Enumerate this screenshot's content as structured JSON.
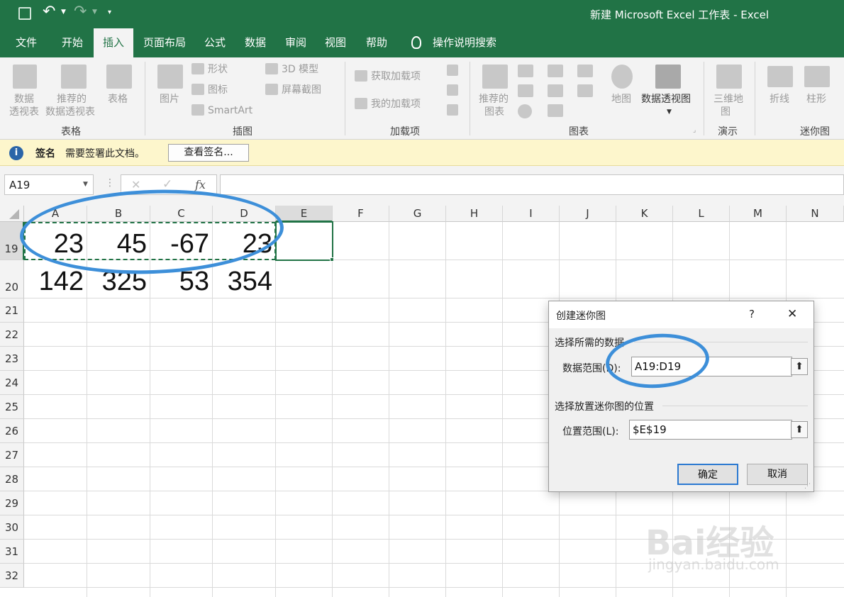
{
  "title": {
    "text": "新建 Microsoft Excel 工作表  -  Excel",
    "save_icon": "save-icon",
    "undo_icon": "undo-icon",
    "redo_icon": "redo-icon",
    "customize_icon": "customize-arrow-icon"
  },
  "menu": {
    "items": [
      "文件",
      "开始",
      "插入",
      "页面布局",
      "公式",
      "数据",
      "审阅",
      "视图",
      "帮助"
    ],
    "active": "插入",
    "search_label": "操作说明搜索"
  },
  "ribbon": {
    "pivot_line1": "数据",
    "pivot_line2": "透视表",
    "rec_pivot_line1": "推荐的",
    "rec_pivot_line2": "数据透视表",
    "table": "表格",
    "group_tables": "表格",
    "pictures": "图片",
    "shapes": "形状",
    "icons": "图标",
    "smartart": "SmartArt",
    "model3d": "3D 模型",
    "screenshot": "屏幕截图",
    "group_illustrations": "插图",
    "get_addins": "获取加载项",
    "my_addins": "我的加载项",
    "group_addins": "加载项",
    "rec_charts_line1": "推荐的",
    "rec_charts_line2": "图表",
    "map": "地图",
    "pivot_chart": "数据透视图",
    "group_charts": "图表",
    "map3d_line1": "三维地",
    "map3d_line2": "图",
    "group_tours": "演示",
    "spark_line": "折线",
    "spark_column": "柱形",
    "group_sparklines": "迷你图"
  },
  "message_bar": {
    "icon": "info-icon",
    "title": "签名",
    "text": "需要签署此文档。",
    "button": "查看签名..."
  },
  "formula_bar": {
    "name_box": "A19",
    "cancel": "✕",
    "confirm": "✓",
    "fx": "fx",
    "value": ""
  },
  "sheet": {
    "columns": [
      "A",
      "B",
      "C",
      "D",
      "E",
      "F",
      "G",
      "H",
      "I",
      "J",
      "K",
      "L",
      "M",
      "N"
    ],
    "rows": [
      "19",
      "20",
      "21",
      "22",
      "23",
      "24",
      "25",
      "26",
      "27",
      "28",
      "29",
      "30",
      "31",
      "32"
    ],
    "row19": [
      "23",
      "45",
      "-67",
      "23"
    ],
    "row20": [
      "142",
      "325",
      "53",
      "354"
    ]
  },
  "dialog": {
    "title": "创建迷你图",
    "help": "?",
    "close": "✕",
    "section1": "选择所需的数据",
    "data_range_label": "数据范围(D):",
    "data_range_value": "A19:D19",
    "section2": "选择放置迷你图的位置",
    "location_label": "位置范围(L):",
    "location_value": "$E$19",
    "ok": "确定",
    "cancel": "取消"
  },
  "watermark": {
    "brand": "Bai经验",
    "url": "jingyan.baidu.com"
  },
  "colors": {
    "excel_green": "#217346",
    "annotation_blue": "#3d8fd9",
    "message_bar": "#fdf6cc"
  }
}
